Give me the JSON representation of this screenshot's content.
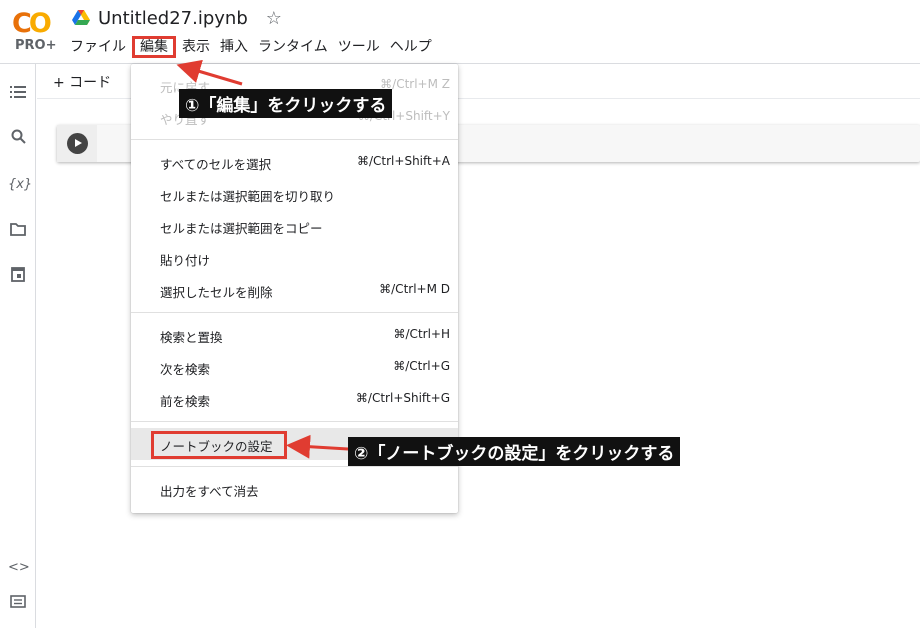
{
  "app": {
    "logo_text": "CO",
    "logo_badge": "PRO+",
    "notebook_title": "Untitled27.ipynb"
  },
  "menubar": {
    "items": [
      "ファイル",
      "編集",
      "表示",
      "挿入",
      "ランタイム",
      "ツール",
      "ヘルプ"
    ],
    "active_index": 1
  },
  "toolbar": {
    "add_code_label": "+ コード"
  },
  "edit_menu": {
    "groups": [
      [
        {
          "label": "元に戻す",
          "shortcut": "⌘/Ctrl+M Z",
          "disabled": true
        },
        {
          "label": "やり直す",
          "shortcut": "⌘/Ctrl+Shift+Y",
          "disabled": true
        }
      ],
      [
        {
          "label": "すべてのセルを選択",
          "shortcut": "⌘/Ctrl+Shift+A"
        },
        {
          "label": "セルまたは選択範囲を切り取り",
          "shortcut": ""
        },
        {
          "label": "セルまたは選択範囲をコピー",
          "shortcut": ""
        },
        {
          "label": "貼り付け",
          "shortcut": ""
        },
        {
          "label": "選択したセルを削除",
          "shortcut": "⌘/Ctrl+M D"
        }
      ],
      [
        {
          "label": "検索と置換",
          "shortcut": "⌘/Ctrl+H"
        },
        {
          "label": "次を検索",
          "shortcut": "⌘/Ctrl+G"
        },
        {
          "label": "前を検索",
          "shortcut": "⌘/Ctrl+Shift+G"
        }
      ],
      [
        {
          "label": "ノートブックの設定",
          "shortcut": "",
          "highlighted": true
        }
      ],
      [
        {
          "label": "出力をすべて消去",
          "shortcut": ""
        }
      ]
    ]
  },
  "annotations": {
    "step1": "①「編集」をクリックする",
    "step2": "②「ノートブックの設定」をクリックする"
  },
  "sidebar_icons": [
    "table-of-contents-icon",
    "search-icon",
    "variables-icon",
    "folder-icon",
    "calendar-icon",
    "code-snippets-icon",
    "terminal-icon"
  ],
  "colors": {
    "annotation_red": "#e03c31",
    "logo_orange": "#e8710a",
    "logo_yellow": "#f9ab00"
  }
}
